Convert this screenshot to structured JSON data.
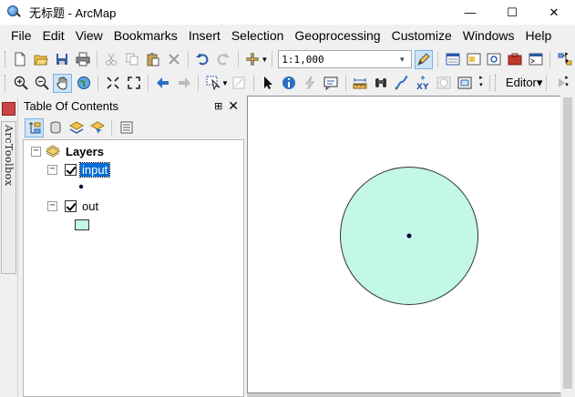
{
  "window": {
    "title": "无标题 - ArcMap",
    "controls": {
      "minimize": "—",
      "maximize": "☐",
      "close": "✕"
    }
  },
  "menu": [
    "File",
    "Edit",
    "View",
    "Bookmarks",
    "Insert",
    "Selection",
    "Geoprocessing",
    "Customize",
    "Windows",
    "Help"
  ],
  "toolbar": {
    "scale_value": "1:1,000",
    "editor_label": "Editor▾"
  },
  "side_dock": {
    "arctoolbox_label": "ArcToolbox"
  },
  "toc": {
    "title": "Table Of Contents",
    "pin": "⊞",
    "close": "✕",
    "root": {
      "label": "Layers",
      "expanded": true
    },
    "layers": [
      {
        "name": "input",
        "checked": true,
        "selected": true,
        "symbol": "point"
      },
      {
        "name": "out",
        "checked": true,
        "selected": false,
        "symbol": "polygon"
      }
    ]
  },
  "map": {
    "polygon_fill": "#c3f7e8",
    "polygon_stroke": "#333333",
    "point_color": "#000033"
  },
  "colors": {
    "selection": "#0a6cd6",
    "active_tool": "#cde4f7"
  }
}
